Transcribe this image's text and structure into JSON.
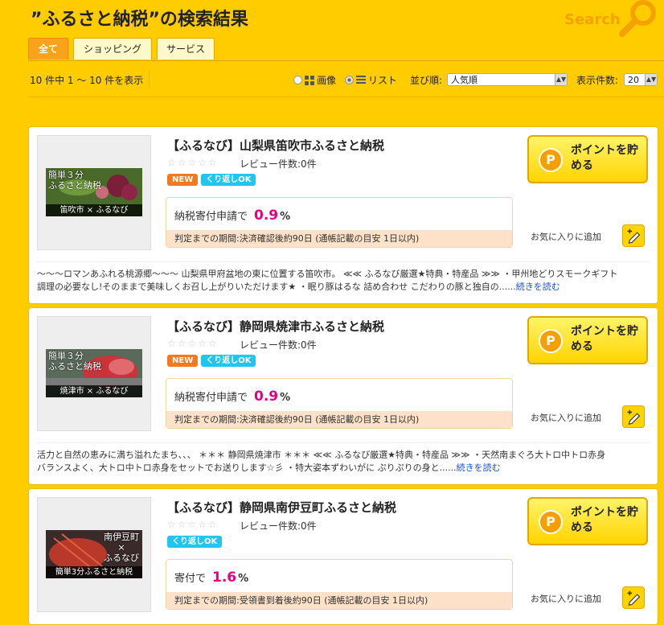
{
  "header": {
    "title": "”ふるさと納税”の検索結果",
    "search_deco": "Search"
  },
  "tabs": [
    {
      "label": "全て",
      "active": true
    },
    {
      "label": "ショッピング",
      "active": false
    },
    {
      "label": "サービス",
      "active": false
    }
  ],
  "toolbar": {
    "count_text": "10 件中 1 〜 10 件を表示",
    "view_image_label": "画像",
    "view_list_label": "リスト",
    "sort_label": "並び順:",
    "sort_value": "人気順",
    "per_page_label": "表示件数:",
    "per_page_value": "20"
  },
  "results": [
    {
      "name": "【ふるなび】山梨県笛吹市ふるさと納税",
      "stars": "☆☆☆☆☆",
      "review_text": "レビュー件数:0件",
      "badges": [
        "NEW",
        "くり返しOK"
      ],
      "thumb_line1": "簡単３分",
      "thumb_line2": "ふるさと納税",
      "thumb_bar": "笛吹市 × ふるなび",
      "rate_label": "納税寄付申請で",
      "rate_value": "0.9",
      "rate_unit": "%",
      "period": "判定までの期間:決済確認後約90日 (通帳記載の目安 1日以内)",
      "point_button": "ポイントを貯める",
      "fav_label": "お気に入りに追加",
      "desc_line1": "〜〜〜ロマンあふれる桃源郷〜〜〜 山梨県甲府盆地の東に位置する笛吹市。 ≪≪ ふるなび厳選★特典・特産品 ≫≫ ・甲州地どりスモークギフト",
      "desc_line2": "調理の必要なし!そのままで美味しくお召し上がりいただけます★ ・眠り豚はるな 詰め合わせ こだわりの豚と独自の......",
      "readmore": "続きを読む"
    },
    {
      "name": "【ふるなび】静岡県焼津市ふるさと納税",
      "stars": "☆☆☆☆☆",
      "review_text": "レビュー件数:0件",
      "badges": [
        "NEW",
        "くり返しOK"
      ],
      "thumb_line1": "簡単３分",
      "thumb_line2": "ふるさと納税",
      "thumb_bar": "焼津市 × ふるなび",
      "rate_label": "納税寄付申請で",
      "rate_value": "0.9",
      "rate_unit": "%",
      "period": "判定までの期間:決済確認後約90日 (通帳記載の目安 1日以内)",
      "point_button": "ポイントを貯める",
      "fav_label": "お気に入りに追加",
      "desc_line1": "活力と自然の恵みに満ち溢れたまち、、、 ＊＊＊ 静岡県焼津市 ＊＊＊ ≪≪ ふるなび厳選★特典・特産品 ≫≫ ・天然南まぐろ大トロ中トロ赤身",
      "desc_line2": "バランスよく、大トロ中トロ赤身をセットでお送りします☆彡 ・特大姿本ずわいがに ぷりぷりの身と......",
      "readmore": "続きを読む"
    },
    {
      "name": "【ふるなび】静岡県南伊豆町ふるさと納税",
      "stars": "☆☆☆☆☆",
      "review_text": "レビュー件数:0件",
      "badges": [
        "くり返しOK"
      ],
      "thumb_line1": "南伊豆町",
      "thumb_line2": "×",
      "thumb_line3": "ふるなび",
      "thumb_bar": "簡単3分ふるさと納税",
      "rate_label": "寄付で",
      "rate_value": "1.6",
      "rate_unit": "%",
      "period": "判定までの期間:受領書到着後約90日 (通帳記載の目安 1日以内)",
      "point_button": "ポイントを貯める",
      "fav_label": "お気に入りに追加"
    }
  ],
  "colors": {
    "background": "#FFCC00",
    "accent_tab": "#F9A21B",
    "rate_value": "#E5007F",
    "badge_new": "#F47A20",
    "badge_repeat": "#1EC6F0",
    "link": "#1A4FCF"
  }
}
